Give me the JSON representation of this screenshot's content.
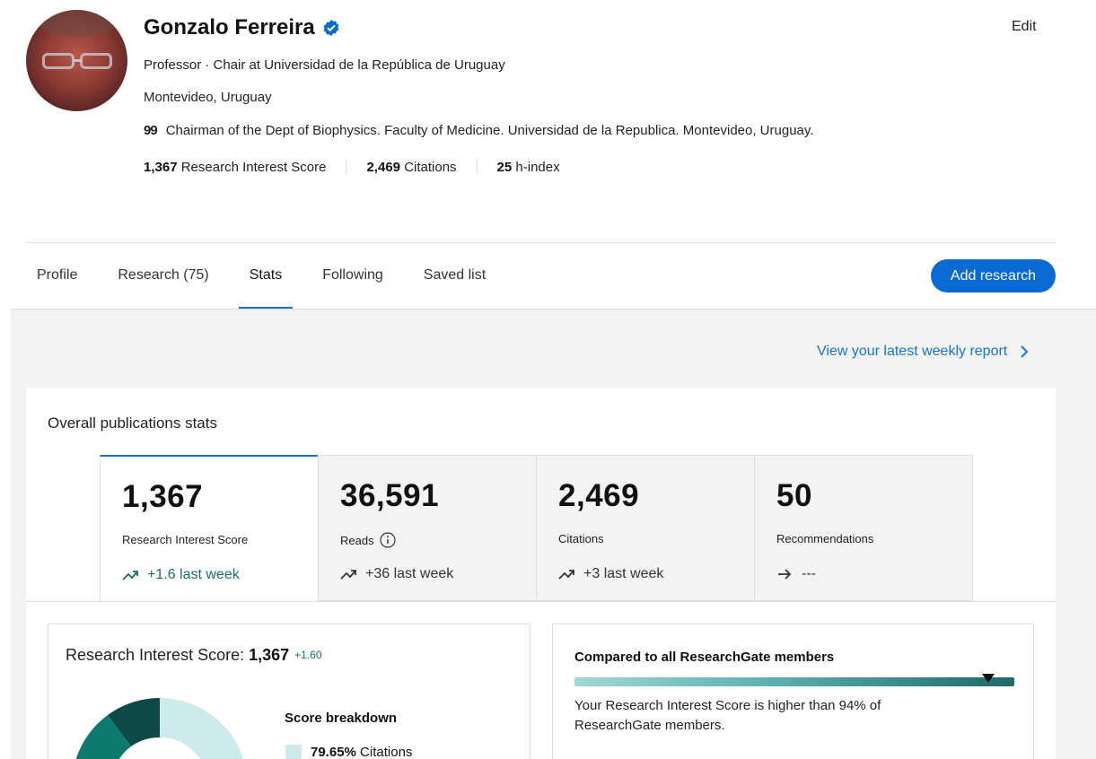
{
  "profile": {
    "name": "Gonzalo Ferreira",
    "position": "Professor · Chair at Universidad de la República de Uruguay",
    "location": "Montevideo, Uruguay",
    "bio_icon": "quote-icon",
    "bio": "Chairman of the Dept of Biophysics. Faculty of Medicine. Universidad de la Republica. Montevideo, Uruguay.",
    "edit_label": "Edit",
    "metrics": [
      {
        "value": "1,367",
        "label": "Research Interest Score"
      },
      {
        "value": "2,469",
        "label": "Citations"
      },
      {
        "value": "25",
        "label": "h-index"
      }
    ]
  },
  "tabs": [
    {
      "label": "Profile",
      "active": false
    },
    {
      "label": "Research (75)",
      "active": false
    },
    {
      "label": "Stats",
      "active": true
    },
    {
      "label": "Following",
      "active": false
    },
    {
      "label": "Saved list",
      "active": false
    }
  ],
  "add_research_label": "Add research",
  "weekly_report_link": "View your latest weekly report",
  "overall": {
    "title": "Overall publications stats",
    "stats": [
      {
        "value": "1,367",
        "label": "Research Interest Score",
        "trend": "+1.6 last week",
        "trend_icon": "trending-up-icon",
        "info": false
      },
      {
        "value": "36,591",
        "label": "Reads",
        "trend": "+36 last week",
        "trend_icon": "trending-up-icon",
        "info": true
      },
      {
        "value": "2,469",
        "label": "Citations",
        "trend": "+3 last week",
        "trend_icon": "trending-up-icon",
        "info": false
      },
      {
        "value": "50",
        "label": "Recommendations",
        "trend": "---",
        "trend_icon": "arrow-right-icon",
        "info": false
      }
    ]
  },
  "ris_panel": {
    "title_prefix": "Research Interest Score: ",
    "score": "1,367",
    "delta": "+1.60",
    "breakdown_title": "Score breakdown",
    "breakdown": [
      {
        "percent": "79.65%",
        "label": "Citations",
        "color": "#cdeaed"
      }
    ],
    "donut_colors": [
      "#cdeaed",
      "#0d7a70",
      "#0d4a47"
    ]
  },
  "compare_panel": {
    "title": "Compared to all ResearchGate members",
    "percentile": 94,
    "text": "Your Research Interest Score is higher than 94% of ResearchGate members."
  },
  "colors": {
    "accent": "#0a6ad4",
    "link": "#1a73c7",
    "trend": "#1d6b68"
  }
}
